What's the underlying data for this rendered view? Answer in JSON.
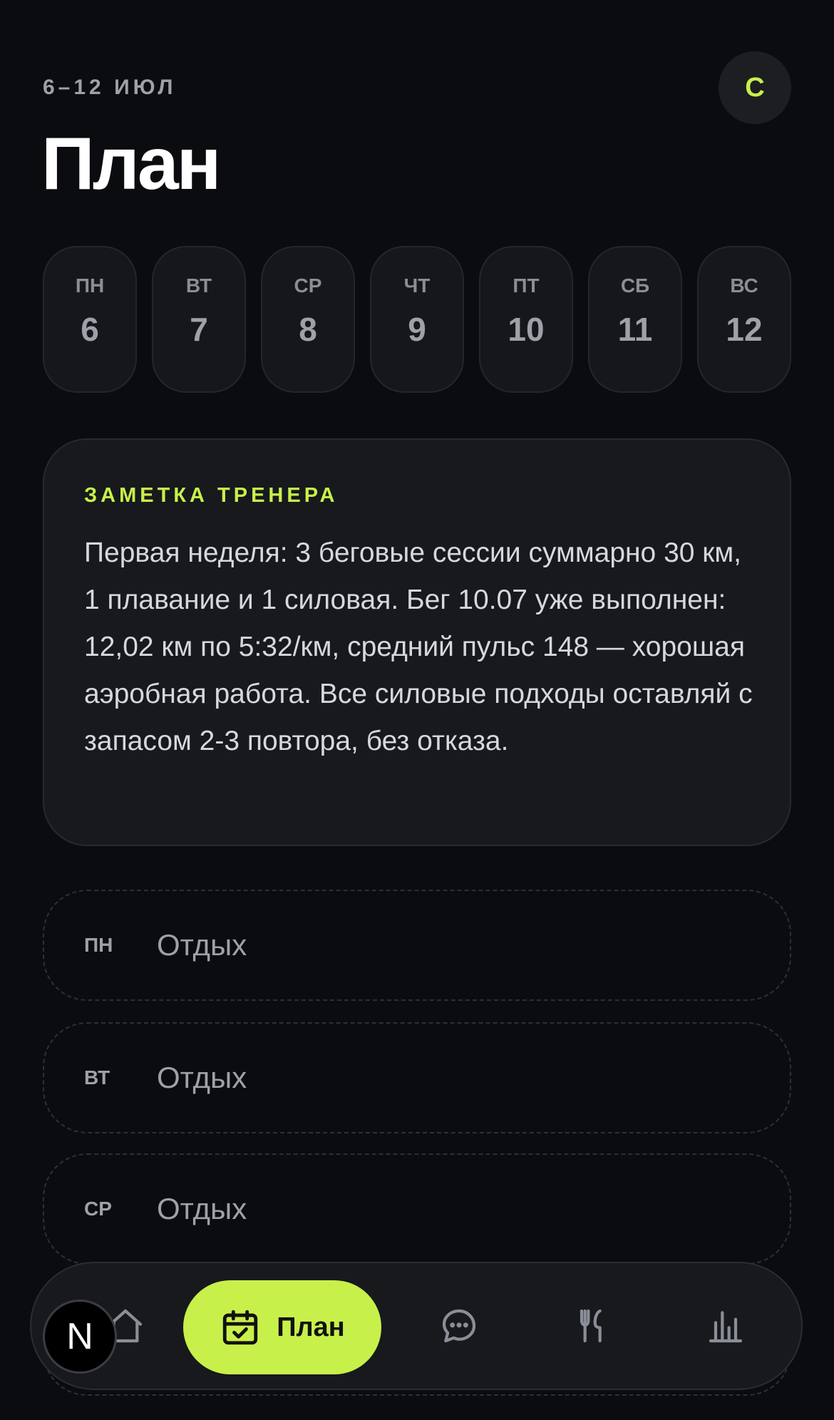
{
  "header": {
    "date_range": "6–12 ИЮЛ",
    "title": "План",
    "avatar_initial": "С"
  },
  "week": [
    {
      "dow": "ПН",
      "day": "6"
    },
    {
      "dow": "ВТ",
      "day": "7"
    },
    {
      "dow": "СР",
      "day": "8"
    },
    {
      "dow": "ЧТ",
      "day": "9"
    },
    {
      "dow": "ПТ",
      "day": "10"
    },
    {
      "dow": "СБ",
      "day": "11"
    },
    {
      "dow": "ВС",
      "day": "12"
    }
  ],
  "coach_note": {
    "label": "ЗАМЕТКА ТРЕНЕРА",
    "text": "Первая неделя: 3 беговые сессии суммарно 30 км, 1 плавание и 1 силовая. Бег 10.07 уже выполнен: 12,02 км по 5:32/км, средний пульс 148 — хорошая аэробная работа. Все силовые подходы оставляй с запасом 2-3 повтора, без отказа."
  },
  "schedule": [
    {
      "dow": "ПН",
      "status": "Отдых"
    },
    {
      "dow": "ВТ",
      "status": "Отдых"
    },
    {
      "dow": "СР",
      "status": "Отдых"
    }
  ],
  "tabbar": {
    "active_label": "План",
    "items": [
      "home-icon",
      "calendar-check-icon",
      "chat-icon",
      "fork-knife-icon",
      "bar-chart-icon"
    ]
  },
  "overlay_badge": "N",
  "colors": {
    "background": "#0b0c0f",
    "accent": "#c8f04a",
    "card": "#17191d"
  }
}
